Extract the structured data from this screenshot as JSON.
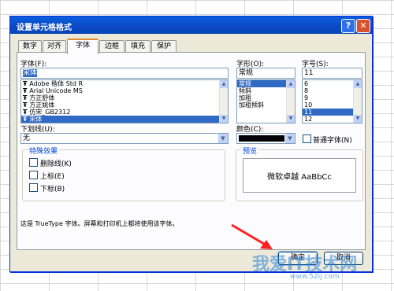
{
  "dialog": {
    "title": "设置单元格格式",
    "help_icon": "?",
    "close_icon": "✕"
  },
  "tabs": [
    "数字",
    "对齐",
    "字体",
    "边框",
    "填充",
    "保护"
  ],
  "active_tab": "字体",
  "font": {
    "label": "字体(F):",
    "value": "宋体",
    "items": [
      "Adobe 楷体 Std R",
      "Arial Unicode MS",
      "方正舒体",
      "方正姚体",
      "仿宋_GB2312",
      "宋体"
    ],
    "selected_index": 5
  },
  "style": {
    "label": "字形(O):",
    "value": "常规",
    "items": [
      "常规",
      "倾斜",
      "加粗",
      "加粗倾斜"
    ],
    "selected_index": 0
  },
  "size": {
    "label": "字号(S):",
    "value": "11",
    "items": [
      "6",
      "8",
      "9",
      "10",
      "11",
      "12"
    ],
    "selected_index": 4
  },
  "underline": {
    "label": "下划线(U):",
    "value": "无"
  },
  "color": {
    "label": "颜色(C):",
    "value": "#000000"
  },
  "normal_font": {
    "label": "普通字体(N)",
    "checked": false
  },
  "effects": {
    "title": "特殊效果",
    "items": [
      {
        "label": "删除线(K)",
        "checked": false
      },
      {
        "label": "上标(E)",
        "checked": false
      },
      {
        "label": "下标(B)",
        "checked": false
      }
    ]
  },
  "preview": {
    "title": "预览",
    "text": "微软卓越  AaBbCc"
  },
  "info": "这是 TrueType 字体。屏幕和打印机上都将使用该字体。",
  "buttons": {
    "ok": "确定",
    "cancel": "取消"
  },
  "watermark": {
    "main": "我爱IT技术网",
    "url": "www.52ij.com"
  }
}
